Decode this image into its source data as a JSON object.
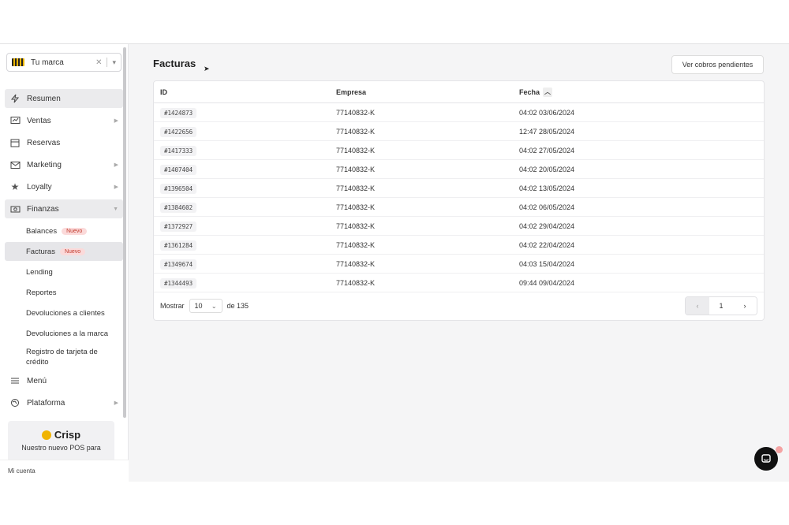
{
  "brand": {
    "name": "Tu marca"
  },
  "nav": {
    "items": [
      {
        "label": "Resumen",
        "icon": "bolt-icon",
        "arrow": false,
        "active": true
      },
      {
        "label": "Ventas",
        "icon": "chart-icon",
        "arrow": true
      },
      {
        "label": "Reservas",
        "icon": "calendar-icon",
        "arrow": false
      },
      {
        "label": "Marketing",
        "icon": "mail-icon",
        "arrow": true
      },
      {
        "label": "Loyalty",
        "icon": "star-icon",
        "arrow": true
      },
      {
        "label": "Finanzas",
        "icon": "cash-icon",
        "arrow": true,
        "active": true
      }
    ],
    "sub": [
      {
        "label": "Balances",
        "badge": "Nuevo"
      },
      {
        "label": "Facturas",
        "badge": "Nuevo",
        "active": true
      },
      {
        "label": "Lending"
      },
      {
        "label": "Reportes"
      },
      {
        "label": "Devoluciones a clientes"
      },
      {
        "label": "Devoluciones a la marca"
      },
      {
        "label": "Registro de tarjeta de crédito"
      }
    ],
    "bottom": [
      {
        "label": "Menú",
        "icon": "menu-icon",
        "arrow": false
      },
      {
        "label": "Plataforma",
        "icon": "globe-icon",
        "arrow": true
      }
    ]
  },
  "crisp": {
    "title": "Crisp",
    "text": "Nuestro nuevo POS para"
  },
  "account": {
    "label": "Mi cuenta"
  },
  "page": {
    "title": "Facturas",
    "pending_button": "Ver cobros pendientes"
  },
  "table": {
    "headers": {
      "id": "ID",
      "empresa": "Empresa",
      "fecha": "Fecha"
    },
    "rows": [
      {
        "id": "#1424873",
        "empresa": "77140832-K",
        "fecha": "04:02 03/06/2024"
      },
      {
        "id": "#1422656",
        "empresa": "77140832-K",
        "fecha": "12:47 28/05/2024"
      },
      {
        "id": "#1417333",
        "empresa": "77140832-K",
        "fecha": "04:02 27/05/2024"
      },
      {
        "id": "#1407404",
        "empresa": "77140832-K",
        "fecha": "04:02 20/05/2024"
      },
      {
        "id": "#1396504",
        "empresa": "77140832-K",
        "fecha": "04:02 13/05/2024"
      },
      {
        "id": "#1384602",
        "empresa": "77140832-K",
        "fecha": "04:02 06/05/2024"
      },
      {
        "id": "#1372927",
        "empresa": "77140832-K",
        "fecha": "04:02 29/04/2024"
      },
      {
        "id": "#1361284",
        "empresa": "77140832-K",
        "fecha": "04:02 22/04/2024"
      },
      {
        "id": "#1349674",
        "empresa": "77140832-K",
        "fecha": "04:03 15/04/2024"
      },
      {
        "id": "#1344493",
        "empresa": "77140832-K",
        "fecha": "09:44 09/04/2024"
      }
    ],
    "footer": {
      "show_label": "Mostrar",
      "page_size": "10",
      "total_label": "de 135",
      "current_page": "1"
    }
  }
}
